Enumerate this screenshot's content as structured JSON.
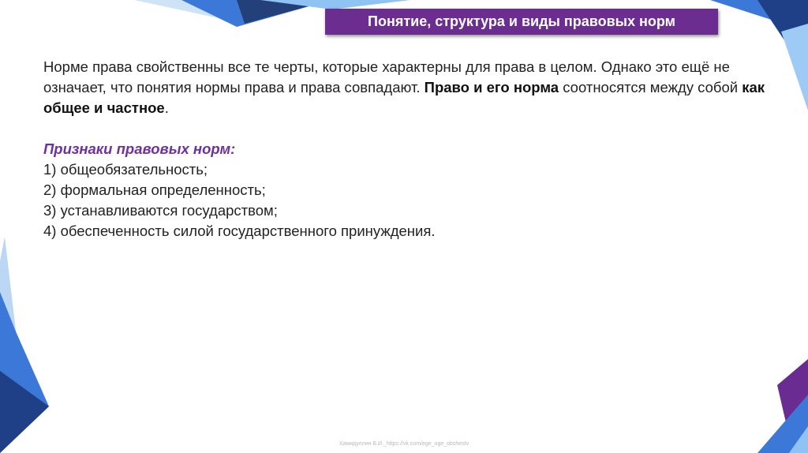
{
  "slide": {
    "title": "Понятие, структура и виды правовых норм",
    "paragraph": {
      "part1": "Норме права свойственны все те черты, которые характерны для права в целом. Однако это ещё не означает, что понятия нормы права и права совпадают. ",
      "bold1": "Право и его норма",
      "part2": " соотносятся между собой ",
      "bold2": "как общее и частное",
      "part3": "."
    },
    "features_heading": "Признаки правовых норм:",
    "features": [
      "1) общеобязательность;",
      "2) формальная определенность;",
      "3) устанавливаются государством;",
      "4) обеспеченность силой государственного принуждения."
    ],
    "footer": "Хамидуллин Б.И._https://vk.com/ege_oge_obshestv"
  },
  "colors": {
    "title_bg": "#6b2d8f",
    "heading": "#7030a0",
    "accent_blue": "#2f6fd6",
    "accent_purple": "#6a2c91",
    "accent_light_blue": "#7fb6f0"
  }
}
